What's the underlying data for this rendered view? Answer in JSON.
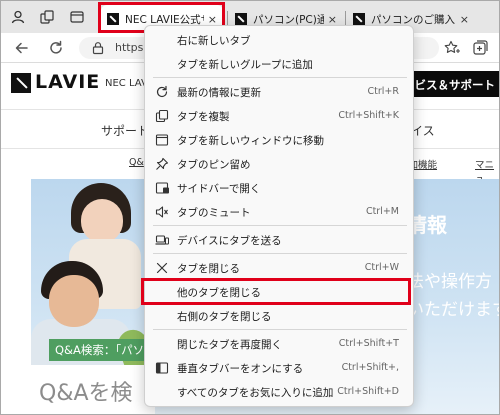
{
  "tabs": [
    {
      "title": "NEC LAVIE公式サイ",
      "active": true
    },
    {
      "title": "パソコン(PC)通販のN",
      "active": false
    },
    {
      "title": "パソコンのご購入は N",
      "active": false
    }
  ],
  "tab_close_glyph": "×",
  "toolbar": {
    "url": "https://",
    "icons": [
      "back-icon",
      "refresh-icon",
      "lock-icon",
      "favorites-icon",
      "collections-icon",
      "copilot-icon"
    ]
  },
  "page": {
    "logo": "LAVIE",
    "brand": "NEC LAVIE",
    "service_button": "ービス＆サポート",
    "subnav_left": "サポート",
    "subnav_right": "イス",
    "links": [
      "Q&",
      "追加機能",
      "マニュ"
    ],
    "hero_headline": "情報",
    "hero_line2": "法や操作方",
    "hero_line3": "いただけます",
    "qa_label": "Q&A検索：「パソコン",
    "qa_box": "Q&Aを検"
  },
  "context_menu": {
    "highlight_color": "#e0001a",
    "items": [
      {
        "label": "右に新しいタブ",
        "shortcut": "",
        "icon": ""
      },
      {
        "label": "タブを新しいグループに追加",
        "shortcut": "",
        "icon": ""
      },
      {
        "label": "最新の情報に更新",
        "shortcut": "Ctrl+R",
        "icon": "refresh-icon"
      },
      {
        "label": "タブを複製",
        "shortcut": "Ctrl+Shift+K",
        "icon": "duplicate-icon"
      },
      {
        "label": "タブを新しいウィンドウに移動",
        "shortcut": "",
        "icon": "new-window-icon"
      },
      {
        "label": "タブのピン留め",
        "shortcut": "",
        "icon": "pin-icon"
      },
      {
        "label": "サイドバーで開く",
        "shortcut": "",
        "icon": "sidebar-icon"
      },
      {
        "label": "タブのミュート",
        "shortcut": "Ctrl+M",
        "icon": "mute-icon"
      },
      {
        "label": "デバイスにタブを送る",
        "shortcut": "",
        "icon": "send-device-icon"
      },
      {
        "label": "タブを閉じる",
        "shortcut": "Ctrl+W",
        "icon": "close-icon"
      },
      {
        "label": "他のタブを閉じる",
        "shortcut": "",
        "icon": "",
        "highlighted": true
      },
      {
        "label": "右側のタブを閉じる",
        "shortcut": "",
        "icon": ""
      },
      {
        "label": "閉じたタブを再度開く",
        "shortcut": "Ctrl+Shift+T",
        "icon": ""
      },
      {
        "label": "垂直タブバーをオンにする",
        "shortcut": "Ctrl+Shift+,",
        "icon": "vertical-tabs-icon"
      },
      {
        "label": "すべてのタブをお気に入りに追加",
        "shortcut": "Ctrl+Shift+D",
        "icon": ""
      }
    ]
  }
}
